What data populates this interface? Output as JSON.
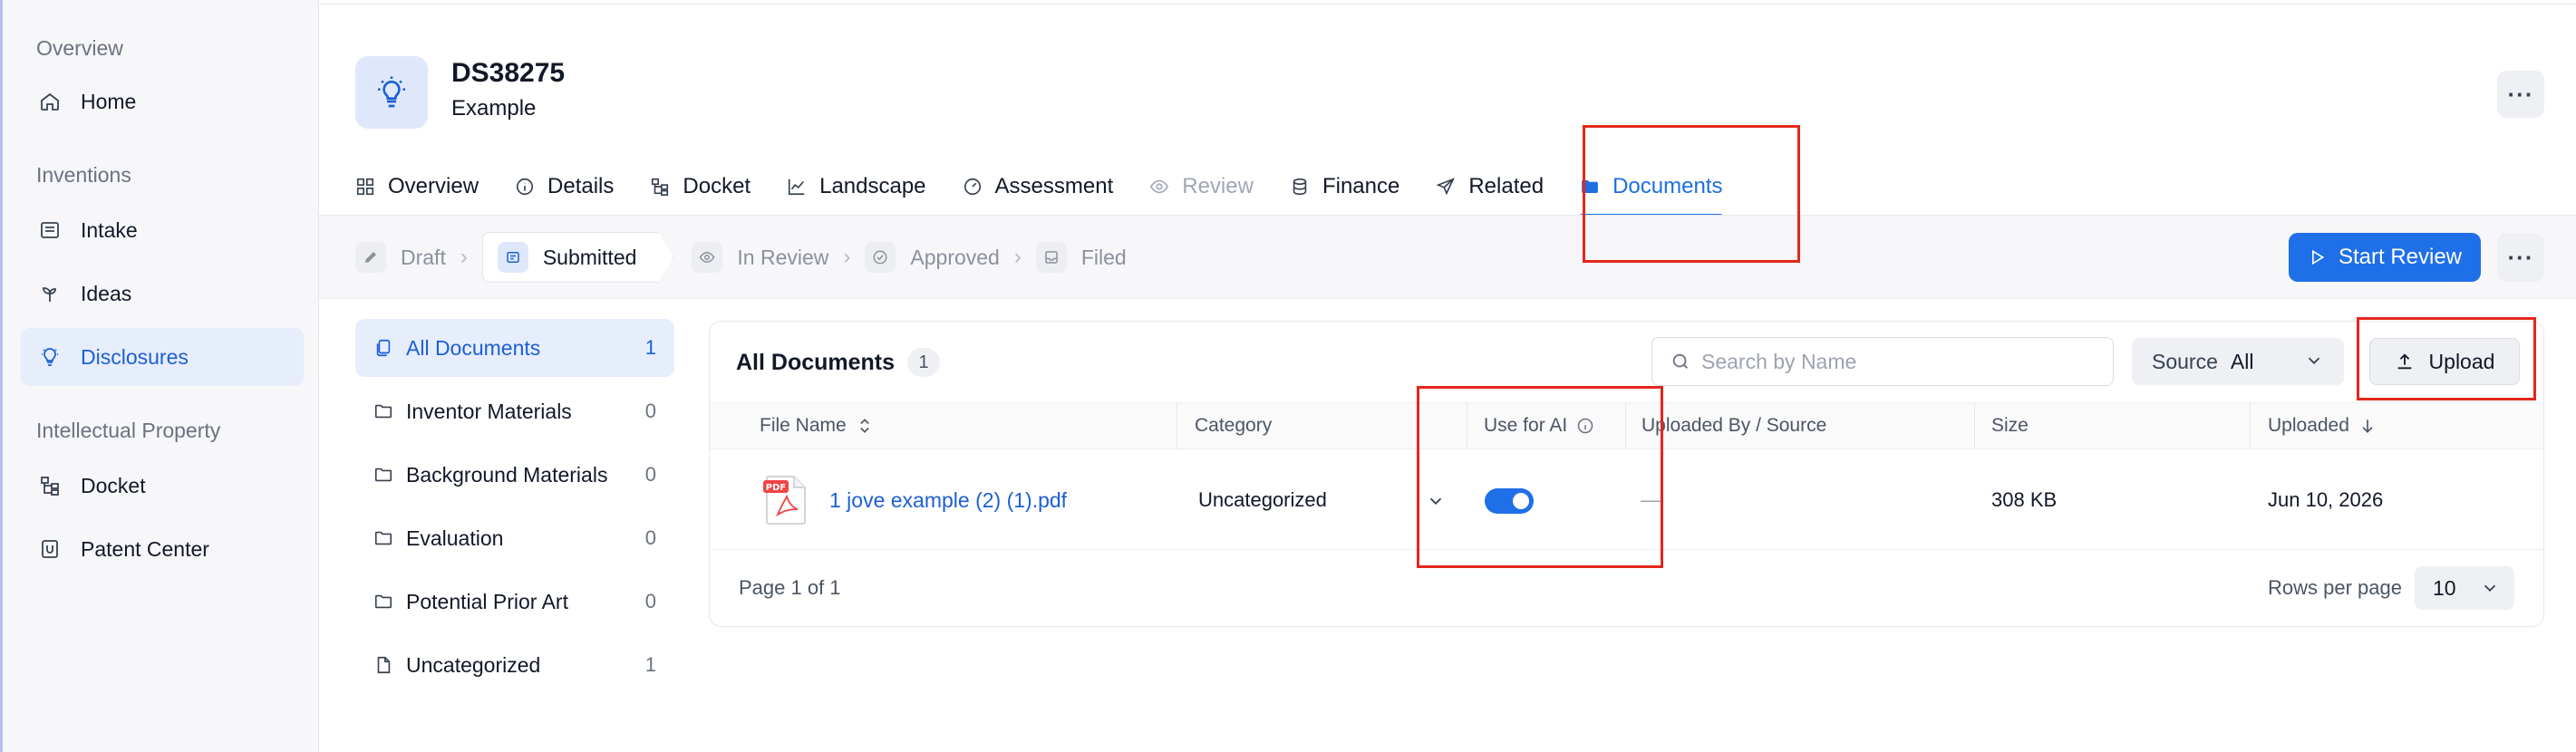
{
  "sidebar": {
    "sections": [
      {
        "label": "Overview",
        "items": [
          {
            "label": "Home",
            "icon": "home-icon"
          }
        ]
      },
      {
        "label": "Inventions",
        "items": [
          {
            "label": "Intake",
            "icon": "inbox-icon"
          },
          {
            "label": "Ideas",
            "icon": "sprout-icon"
          },
          {
            "label": "Disclosures",
            "icon": "lightbulb-icon",
            "active": true
          }
        ]
      },
      {
        "label": "Intellectual Property",
        "items": [
          {
            "label": "Docket",
            "icon": "tree-icon"
          },
          {
            "label": "Patent Center",
            "icon": "badge-icon"
          }
        ]
      }
    ]
  },
  "header": {
    "title": "DS38275",
    "subtitle": "Example",
    "more_label": "···"
  },
  "tabs": [
    {
      "label": "Overview",
      "icon": "grid-icon"
    },
    {
      "label": "Details",
      "icon": "info-icon"
    },
    {
      "label": "Docket",
      "icon": "tree-icon"
    },
    {
      "label": "Landscape",
      "icon": "chart-icon"
    },
    {
      "label": "Assessment",
      "icon": "gauge-icon"
    },
    {
      "label": "Review",
      "icon": "eye-icon",
      "disabled": true
    },
    {
      "label": "Finance",
      "icon": "coins-icon"
    },
    {
      "label": "Related",
      "icon": "share-icon"
    },
    {
      "label": "Documents",
      "icon": "folder-icon",
      "active": true
    }
  ],
  "workflow": {
    "steps": [
      {
        "label": "Draft",
        "icon": "pencil-icon"
      },
      {
        "label": "Submitted",
        "icon": "document-icon",
        "current": true
      },
      {
        "label": "In Review",
        "icon": "eye-icon"
      },
      {
        "label": "Approved",
        "icon": "check-circle-icon"
      },
      {
        "label": "Filed",
        "icon": "tray-icon"
      }
    ],
    "start_review_label": "Start Review"
  },
  "categories": [
    {
      "label": "All Documents",
      "count": "1",
      "active": true
    },
    {
      "label": "Inventor Materials",
      "count": "0"
    },
    {
      "label": "Background Materials",
      "count": "0"
    },
    {
      "label": "Evaluation",
      "count": "0"
    },
    {
      "label": "Potential Prior Art",
      "count": "0"
    },
    {
      "label": "Uncategorized",
      "count": "1"
    }
  ],
  "documents": {
    "title": "All Documents",
    "count": "1",
    "search_placeholder": "Search by Name",
    "source_label": "Source",
    "source_value": "All",
    "upload_label": "Upload",
    "columns": {
      "file_name": "File Name",
      "category": "Category",
      "use_for_ai": "Use for AI",
      "uploaded_by": "Uploaded By / Source",
      "size": "Size",
      "uploaded": "Uploaded"
    },
    "rows": [
      {
        "file_name": "1 jove example (2) (1).pdf",
        "file_badge": "PDF",
        "category": "Uncategorized",
        "use_for_ai": true,
        "uploaded_by": "—",
        "size": "308 KB",
        "uploaded": "Jun 10, 2026"
      }
    ],
    "pagination": "Page 1 of 1",
    "rows_per_page_label": "Rows per page",
    "rows_per_page_value": "10"
  },
  "colors": {
    "accent": "#1f6fe8",
    "active_bg": "#e6edfb",
    "annotation_red": "#e3271d"
  }
}
